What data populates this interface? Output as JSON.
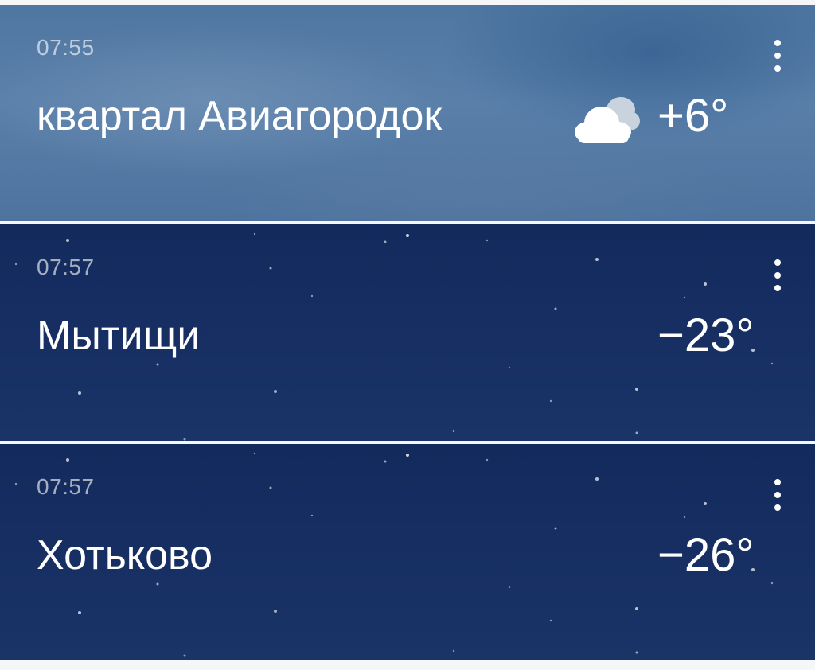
{
  "cities": [
    {
      "time": "07:55",
      "name": "квартал Авиагородок",
      "temperature": "+6°",
      "condition_icon": "cloud-icon",
      "theme": "day"
    },
    {
      "time": "07:57",
      "name": "Мытищи",
      "temperature": "−23°",
      "condition_icon": "moon-icon",
      "theme": "night"
    },
    {
      "time": "07:57",
      "name": "Хотьково",
      "temperature": "−26°",
      "condition_icon": "moon-icon",
      "theme": "night"
    }
  ],
  "icons": {
    "more_menu": "more-vertical-icon"
  },
  "colors": {
    "day_background": "#5a80aa",
    "night_background": "#172f63",
    "moon": "#f6b92b",
    "cloud": "#ffffff",
    "text": "#ffffff",
    "separator": "#f4f6f8"
  }
}
